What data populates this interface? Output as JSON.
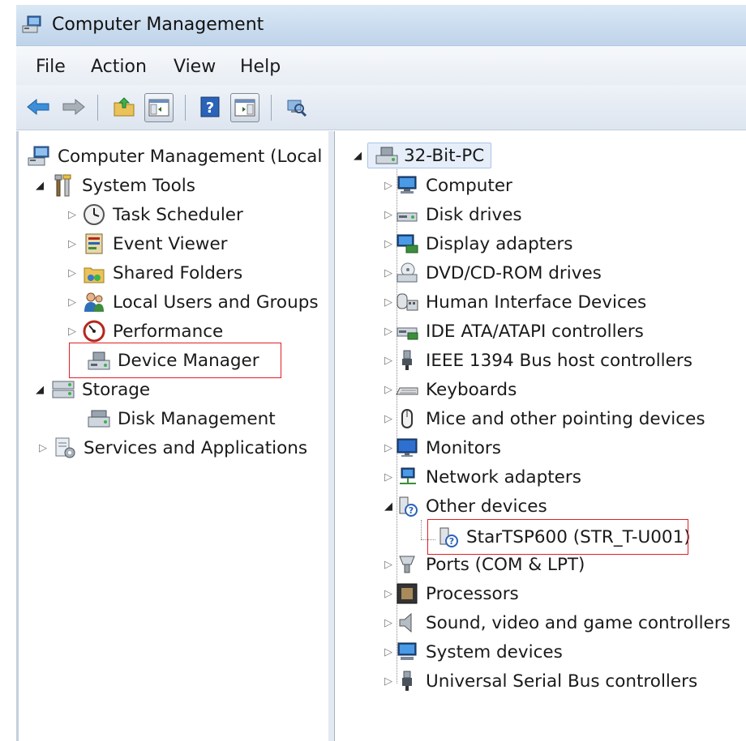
{
  "window": {
    "title": "Computer Management"
  },
  "menu": {
    "file": "File",
    "action": "Action",
    "view": "View",
    "help": "Help"
  },
  "tree": {
    "root": "Computer Management (Local",
    "system_tools": "System Tools",
    "task_scheduler": "Task Scheduler",
    "event_viewer": "Event Viewer",
    "shared_folders": "Shared Folders",
    "local_users": "Local Users and Groups",
    "performance": "Performance",
    "device_manager": "Device Manager",
    "storage": "Storage",
    "disk_management": "Disk Management",
    "services": "Services and Applications"
  },
  "devices": {
    "root": "32-Bit-PC",
    "items": [
      "Computer",
      "Disk drives",
      "Display adapters",
      "DVD/CD-ROM drives",
      "Human Interface Devices",
      "IDE ATA/ATAPI controllers",
      "IEEE 1394 Bus host controllers",
      "Keyboards",
      "Mice and other pointing devices",
      "Monitors",
      "Network adapters",
      "Other devices",
      "StarTSP600 (STR_T-U001)",
      "Ports (COM & LPT)",
      "Processors",
      "Sound, video and game controllers",
      "System devices",
      "Universal Serial Bus controllers"
    ]
  },
  "colors": {
    "highlight": "#e31e24",
    "accent": "#3a78c8"
  }
}
